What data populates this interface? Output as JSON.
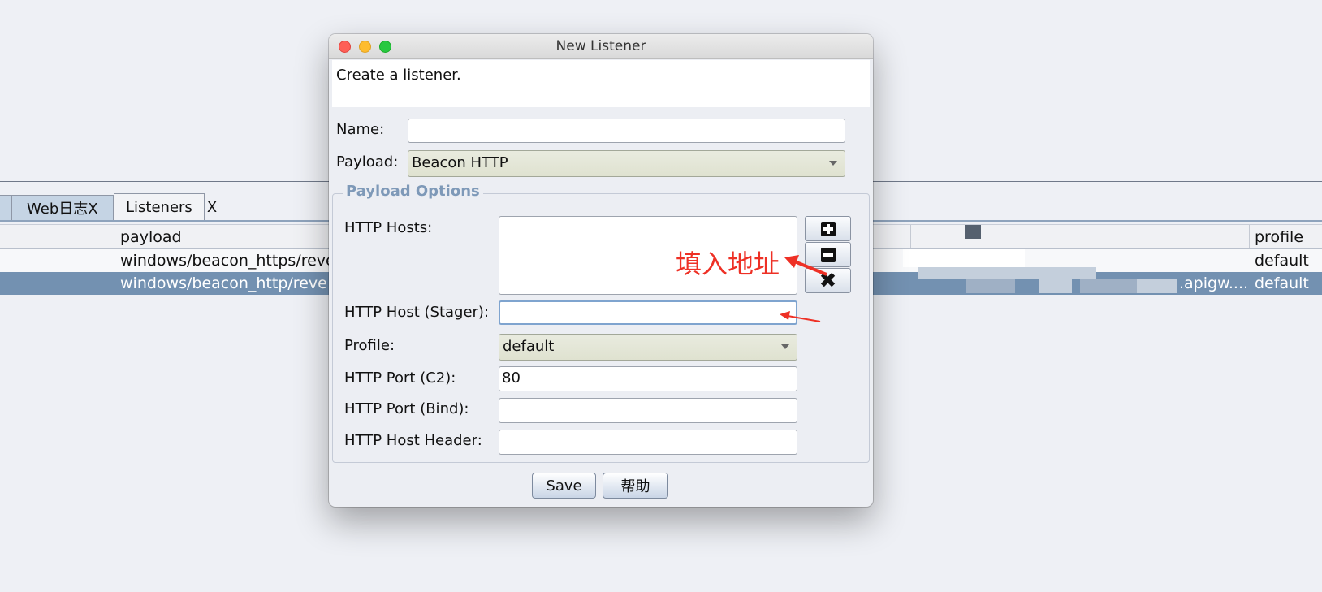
{
  "app": {
    "tabs": [
      {
        "label": "Web日志X"
      },
      {
        "label": "Listeners",
        "close": "X"
      }
    ],
    "table": {
      "headers": {
        "payload": "payload",
        "profile": "profile"
      },
      "rows": [
        {
          "payload": "windows/beacon_https/reve",
          "host": "",
          "profile": "default"
        },
        {
          "payload": "windows/beacon_http/reve",
          "host": ".apigw....",
          "profile": "default",
          "selected": true
        }
      ]
    }
  },
  "dialog": {
    "title": "New Listener",
    "description": "Create a listener.",
    "name": {
      "label": "Name:",
      "value": ""
    },
    "payload": {
      "label": "Payload:",
      "value": "Beacon HTTP"
    },
    "options_title": "Payload Options",
    "http_hosts": {
      "label": "HTTP Hosts:",
      "items": []
    },
    "http_host_stager": {
      "label": "HTTP Host (Stager):",
      "value": ""
    },
    "profile": {
      "label": "Profile:",
      "value": "default"
    },
    "http_port_c2": {
      "label": "HTTP Port (C2):",
      "value": "80"
    },
    "http_port_bind": {
      "label": "HTTP Port (Bind):",
      "value": ""
    },
    "http_host_header": {
      "label": "HTTP Host Header:",
      "value": ""
    },
    "buttons": {
      "save": "Save",
      "help": "帮助"
    },
    "list_buttons": {
      "add_icon": "plus-icon",
      "remove_icon": "minus-icon",
      "clear_icon": "x-icon"
    }
  },
  "annotation": {
    "text": "填入地址",
    "color": "#ee3025"
  },
  "colors": {
    "selected_row": "#7391b1",
    "options_title": "#7e99b8"
  }
}
